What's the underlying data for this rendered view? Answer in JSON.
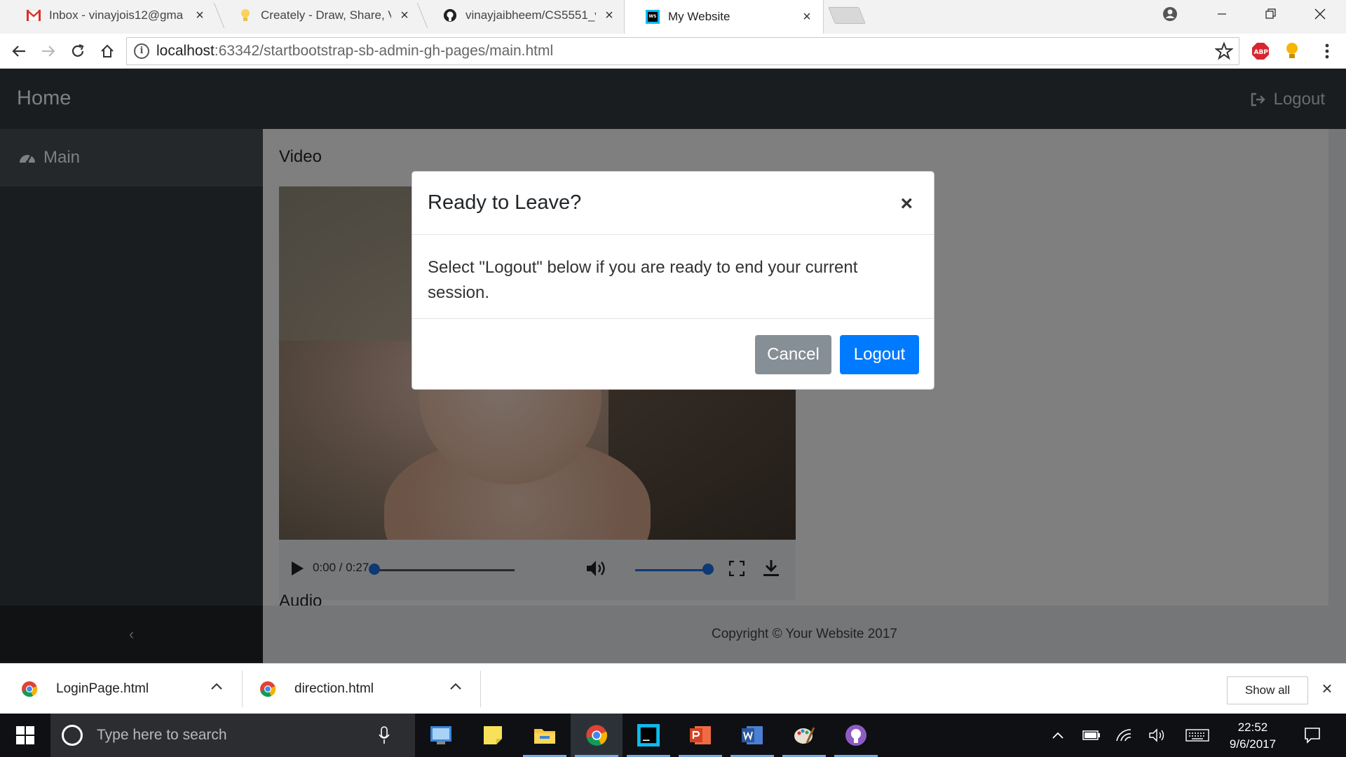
{
  "browser": {
    "tabs": [
      {
        "title": "Inbox - vinayjois12@gma",
        "icon": "gmail-icon"
      },
      {
        "title": "Creately - Draw, Share, V",
        "icon": "creately-bulb-icon"
      },
      {
        "title": "vinayjaibheem/CS5551_v",
        "icon": "github-icon"
      },
      {
        "title": "My Website",
        "icon": "webstorm-icon",
        "active": true
      }
    ],
    "address": {
      "host": "localhost",
      "path": ":63342/startbootstrap-sb-admin-gh-pages/main.html"
    },
    "abp_label": "ABP"
  },
  "site": {
    "brand": "Home",
    "nav_logout": "Logout",
    "sidebar": {
      "items": [
        {
          "label": "Main",
          "icon": "dashboard-icon"
        }
      ],
      "toggler": "‹"
    },
    "sections": {
      "video": "Video",
      "audio": "Audio"
    },
    "video_player": {
      "time": "0:00 / 0:27",
      "progress": 0.0,
      "volume": 1.0
    },
    "footer": "Copyright © Your Website 2017"
  },
  "modal": {
    "title": "Ready to Leave?",
    "close": "×",
    "body": "Select \"Logout\" below if you are ready to end your current session.",
    "cancel": "Cancel",
    "logout": "Logout"
  },
  "downloads": {
    "items": [
      {
        "name": "LoginPage.html"
      },
      {
        "name": "direction.html"
      }
    ],
    "show_all": "Show all"
  },
  "taskbar": {
    "search_placeholder": "Type here to search",
    "time": "22:52",
    "date": "9/6/2017"
  },
  "colors": {
    "primary": "#007bff",
    "secondary": "#868e96",
    "navbar": "#343a40"
  }
}
